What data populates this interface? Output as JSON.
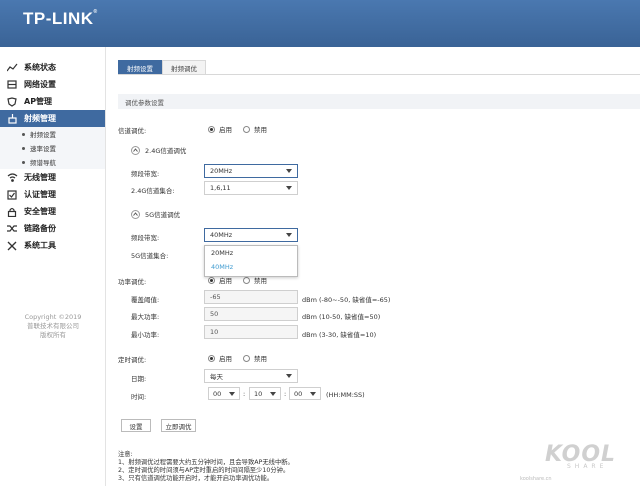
{
  "header": {
    "brand": "TP-LINK",
    "brand_mark": "®"
  },
  "sidebar": {
    "items": [
      {
        "label": "系统状态",
        "icon": "chart-line-icon"
      },
      {
        "label": "网络设置",
        "icon": "network-icon"
      },
      {
        "label": "AP管理",
        "icon": "shield-ap-icon"
      },
      {
        "label": "射频管理",
        "icon": "radio-frequency-icon"
      },
      {
        "label": "无线管理",
        "icon": "wifi-icon"
      },
      {
        "label": "认证管理",
        "icon": "auth-check-icon"
      },
      {
        "label": "安全管理",
        "icon": "lock-icon"
      },
      {
        "label": "链路备份",
        "icon": "shuffle-icon"
      },
      {
        "label": "系统工具",
        "icon": "tools-icon"
      }
    ],
    "sub_items": [
      "射频设置",
      "速率设置",
      "频谱导航"
    ],
    "copyright": [
      "Copyright ©2019",
      "普联技术有限公司",
      "版权所有"
    ]
  },
  "tabs": [
    "射频设置",
    "射频调优"
  ],
  "section_title": "调优参数设置",
  "channel_opt": {
    "label": "信道调优:",
    "on": "启用",
    "off": "禁用"
  },
  "g24": {
    "title": "2.4G信道调优",
    "bandwidth_label": "频段带宽:",
    "bandwidth_value": "20MHz",
    "set_label": "2.4G信道集合:",
    "set_value": "1,6,11"
  },
  "g5": {
    "title": "5G信道调优",
    "bandwidth_label": "频段带宽:",
    "bandwidth_value": "40MHz",
    "set_label": "5G信道集合:",
    "options": [
      "20MHz",
      "40MHz"
    ]
  },
  "power": {
    "label": "功率调优:",
    "on": "启用",
    "off": "禁用",
    "coverage_label": "覆盖阈值:",
    "coverage_value": "-65",
    "coverage_unit": "dBm  (-80~-50, 缺省值=-65)",
    "max_label": "最大功率:",
    "max_value": "50",
    "max_unit": "dBm  (10-50, 缺省值=50)",
    "min_label": "最小功率:",
    "min_value": "10",
    "min_unit": "dBm  (3-30, 缺省值=10)"
  },
  "timer": {
    "label": "定时调优:",
    "on": "启用",
    "off": "禁用",
    "date_label": "日期:",
    "date_value": "每天",
    "time_label": "时间:",
    "hh": "00",
    "mm": "10",
    "ss": "00",
    "time_format": "(HH:MM:SS)"
  },
  "buttons": {
    "set": "设置",
    "tune_now": "立即调优"
  },
  "notes": {
    "title": "注意:",
    "lines": [
      "1、射频调优过程需要大约五分钟时间，且会导致AP无线中断。",
      "2、定时调优的时间须与AP定时重启的时间间隔至少10分钟。",
      "3、只有信道调优功能开启时，才能开启功率调优功能。"
    ]
  },
  "watermark": {
    "big": "KOOL",
    "small": "SHARE",
    "site": "koolshare.cn"
  },
  "colors": {
    "header": "#3f6aa0",
    "active": "#3f6aa0",
    "option_selected": "#3f9bd0"
  }
}
